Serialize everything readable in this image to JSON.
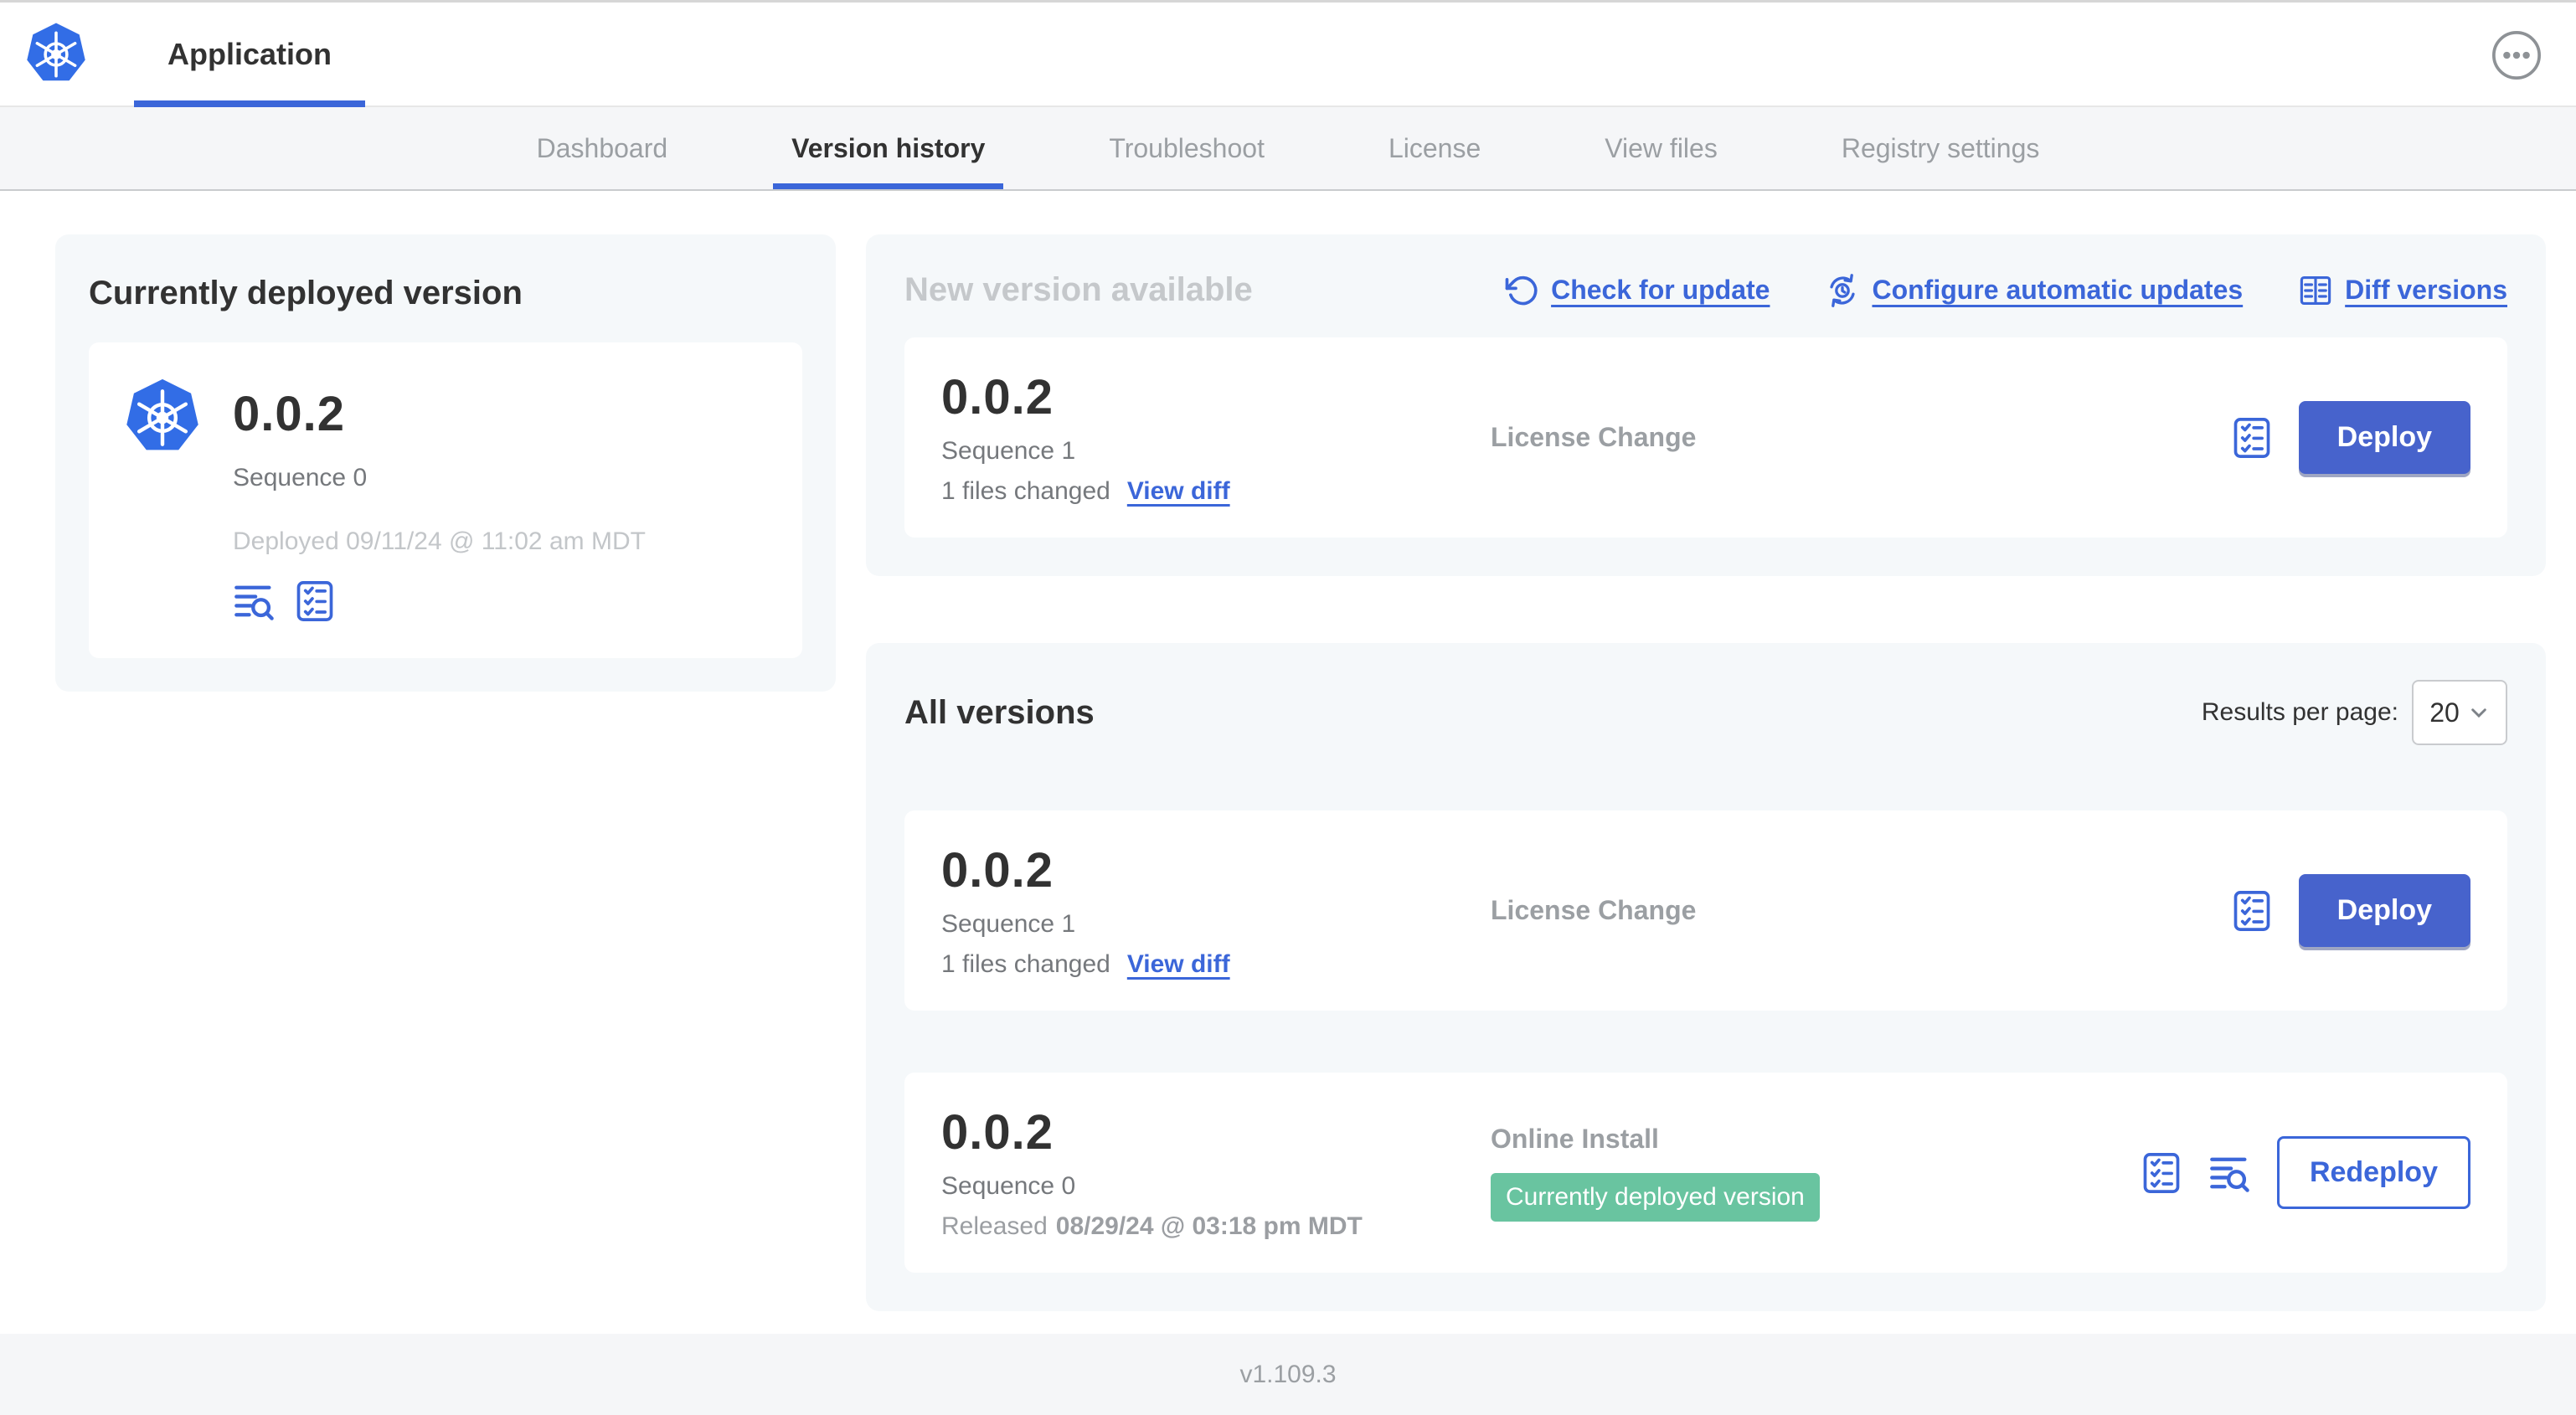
{
  "header": {
    "app_tab_label": "Application",
    "menu_icon": "ellipsis-circle-icon"
  },
  "nav": {
    "active_tab": "Version history",
    "tabs": [
      {
        "label": "Dashboard"
      },
      {
        "label": "Version history"
      },
      {
        "label": "Troubleshoot"
      },
      {
        "label": "License"
      },
      {
        "label": "View files"
      },
      {
        "label": "Registry settings"
      }
    ]
  },
  "current_version_panel": {
    "title": "Currently deployed version",
    "version": "0.0.2",
    "sequence": "Sequence 0",
    "deployed": "Deployed 09/11/24 @ 11:02 am MDT",
    "icons": [
      "view-logs-icon",
      "preflight-checklist-icon"
    ]
  },
  "new_version_panel": {
    "title": "New version available",
    "check_for_update_label": "Check for update",
    "configure_updates_label": "Configure automatic updates",
    "diff_versions_label": "Diff versions",
    "card": {
      "version": "0.0.2",
      "sequence": "Sequence 1",
      "files_changed": "1 files changed",
      "view_diff_label": "View diff",
      "source": "License Change",
      "deploy_label": "Deploy"
    }
  },
  "all_versions_panel": {
    "title": "All versions",
    "results_per_page_label": "Results per page:",
    "results_per_page_value": "20",
    "rows": [
      {
        "version": "0.0.2",
        "sequence": "Sequence 1",
        "files_changed": "1 files changed",
        "view_diff_label": "View diff",
        "source": "License Change",
        "action_label": "Deploy"
      },
      {
        "version": "0.0.2",
        "sequence": "Sequence 0",
        "released_prefix": "Released",
        "released_date": "08/29/24 @ 03:18 pm MDT",
        "source": "Online Install",
        "badge_label": "Currently deployed version",
        "action_label": "Redeploy"
      }
    ]
  },
  "footer": {
    "version_label": "v1.109.3"
  },
  "colors": {
    "logo_blue": "#326de6",
    "accent_blue": "#3b66d9",
    "button_blue": "#4763cc",
    "badge_green": "#69c4a0",
    "panel_gray": "#f5f8fa",
    "subnav_gray": "#f5f6f8",
    "dark_text": "#323232",
    "muted_text": "#9b9fa3",
    "light_text": "#c5c8cb"
  }
}
